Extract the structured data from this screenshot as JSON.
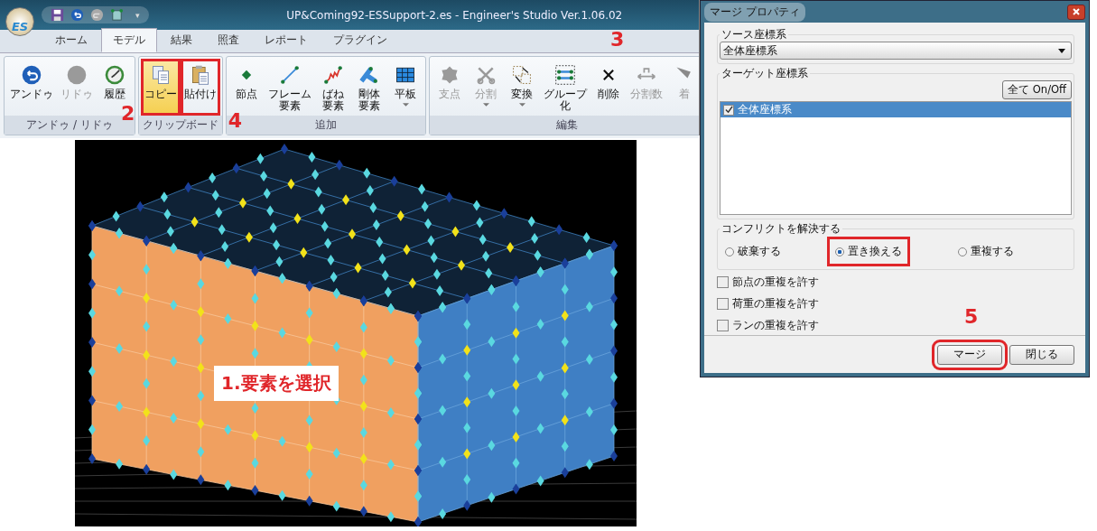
{
  "app_window": {
    "logo_text": "ES",
    "qat_menu": "▾",
    "title": "UP&Coming92-ESSupport-2.es - Engineer's Studio Ver.1.06.02",
    "tabs": [
      {
        "label": "ホーム",
        "selected": false
      },
      {
        "label": "モデル",
        "selected": true
      },
      {
        "label": "結果",
        "selected": false
      },
      {
        "label": "照査",
        "selected": false
      },
      {
        "label": "レポート",
        "selected": false
      },
      {
        "label": "プラグイン",
        "selected": false
      }
    ],
    "ribbon_groups": [
      {
        "label": "アンドゥ / リドゥ",
        "buttons": [
          {
            "lines": [
              "アンドゥ"
            ],
            "disabled": false
          },
          {
            "lines": [
              "リドゥ"
            ],
            "disabled": true
          },
          {
            "lines": [
              "履歴"
            ],
            "disabled": false
          }
        ]
      },
      {
        "label": "クリップボード",
        "buttons": [
          {
            "lines": [
              "コピー"
            ],
            "disabled": false,
            "highlighted": true,
            "callout": {
              "number": "2"
            }
          },
          {
            "lines": [
              "貼付け"
            ],
            "disabled": false,
            "callout": {
              "number": "4"
            }
          }
        ]
      },
      {
        "label": "追加",
        "buttons": [
          {
            "lines": [
              "節点"
            ],
            "disabled": false
          },
          {
            "lines": [
              "フレーム",
              "要素"
            ],
            "disabled": false
          },
          {
            "lines": [
              "ばね",
              "要素"
            ],
            "disabled": false
          },
          {
            "lines": [
              "剛体",
              "要素"
            ],
            "disabled": false
          },
          {
            "lines": [
              "平板"
            ],
            "disabled": false,
            "dropdown": true
          }
        ]
      },
      {
        "label": "編集",
        "buttons": [
          {
            "lines": [
              "支点"
            ],
            "disabled": true
          },
          {
            "lines": [
              "分割"
            ],
            "disabled": true,
            "dropdown": true
          },
          {
            "lines": [
              "変換"
            ],
            "disabled": false,
            "dropdown": true
          },
          {
            "lines": [
              "グループ",
              "化"
            ],
            "disabled": false
          },
          {
            "lines": [
              "削除"
            ],
            "disabled": false,
            "callout": {
              "number": "3"
            }
          },
          {
            "lines": [
              "分割数"
            ],
            "disabled": true
          },
          {
            "lines": [
              "着"
            ],
            "disabled": true
          }
        ]
      }
    ]
  },
  "viewport": {
    "annotation": "1.要素を選択"
  },
  "dialog": {
    "title": "マージ プロパティ",
    "source": {
      "legend": "ソース座標系",
      "value": "全体座標系"
    },
    "target": {
      "legend": "ターゲット座標系",
      "toggle_button": "全て On/Off",
      "items": [
        {
          "label": "全体座標系",
          "checked": true,
          "selected": true
        }
      ]
    },
    "conflict": {
      "legend": "コンフリクトを解決する",
      "options": [
        {
          "label": "破棄する",
          "selected": false
        },
        {
          "label": "置き換える",
          "selected": true,
          "callout": true
        },
        {
          "label": "重複する",
          "selected": false
        }
      ]
    },
    "options": [
      {
        "label": "節点の重複を許す",
        "checked": false
      },
      {
        "label": "荷重の重複を許す",
        "checked": false
      },
      {
        "label": "ランの重複を許す",
        "checked": false
      }
    ],
    "buttons": [
      {
        "label": "マージ",
        "callout": {
          "number": "5"
        }
      },
      {
        "label": "閉じる"
      }
    ]
  }
}
